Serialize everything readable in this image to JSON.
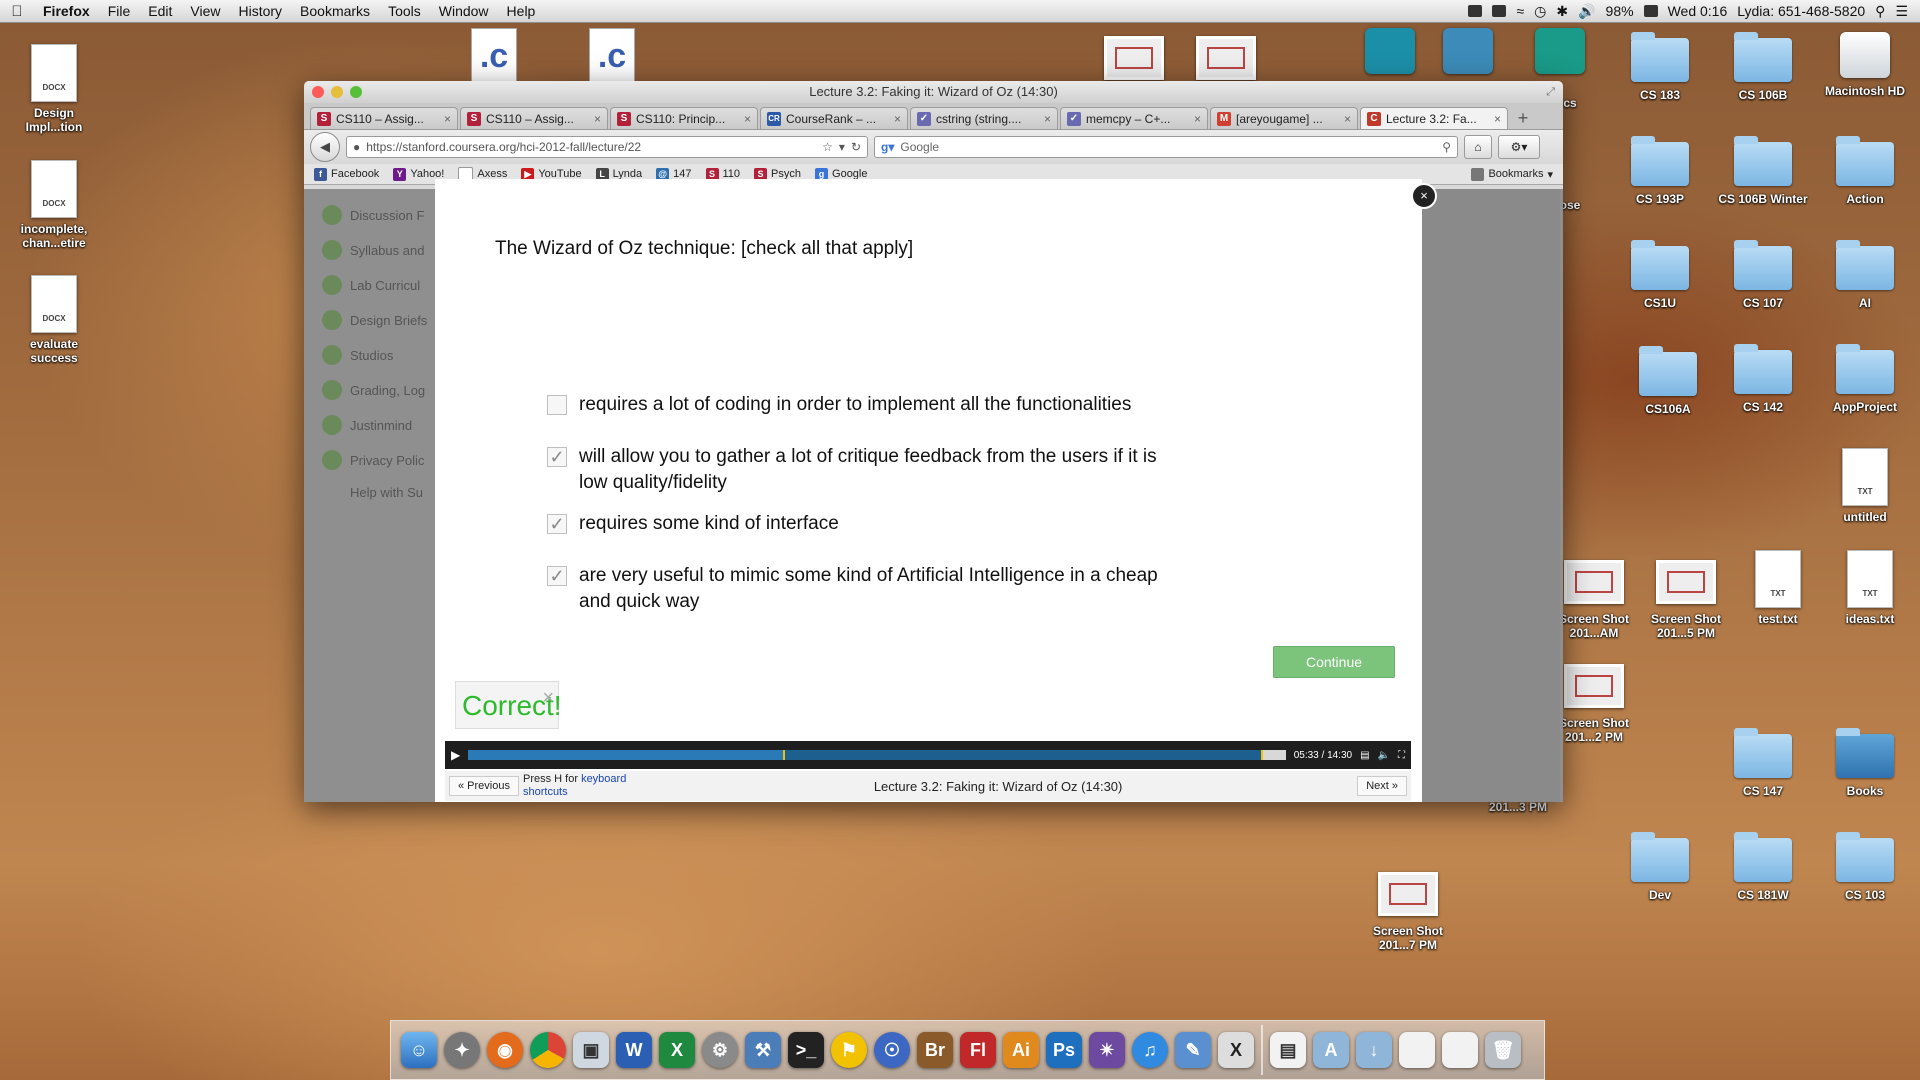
{
  "menubar": {
    "apple": "",
    "items": [
      "Firefox",
      "File",
      "Edit",
      "View",
      "History",
      "Bookmarks",
      "Tools",
      "Window",
      "Help"
    ],
    "battery": "98%",
    "clock": "Wed 0:16",
    "user": "Lydia: 651-468-5820"
  },
  "desktop_left": [
    {
      "label": "Design\nImpl...tion",
      "type": "DOCX"
    },
    {
      "label": "incomplete,\nchan...etire",
      "type": "DOCX"
    },
    {
      "label": "evaluate\nsuccess",
      "type": "DOCX"
    }
  ],
  "desktop_right": {
    "row1": [
      "CS 183",
      "CS 106B",
      "Macintosh HD"
    ],
    "row2": [
      "CS 193P",
      "CS 106B Winter",
      "Action"
    ],
    "row3": [
      "CS1U",
      "CS 107",
      "AI"
    ],
    "row4": [
      "CS106A",
      "CS 142",
      "AppProject"
    ],
    "untitled": "untitled",
    "txt_type": "TXT",
    "shot_row": [
      "Screen Shot 201...AM",
      "Screen Shot 201...5 PM",
      "test.txt",
      "ideas.txt"
    ],
    "shot2": "Screen Shot 201...2 PM",
    "bottom1": [
      "CS 147",
      "Books"
    ],
    "bottom2": [
      "Dev",
      "CS 181W",
      "CS 103"
    ],
    "shot3": "Screen Shot 201...3 PM",
    "shot4": "Screen Shot 201...7 PM",
    "partial": [
      "cs",
      "ose"
    ]
  },
  "window": {
    "title": "Lecture 3.2: Faking it: Wizard of Oz (14:30)",
    "tabs": [
      {
        "label": "CS110 – Assig...",
        "fav": "S",
        "color": "#b3203a"
      },
      {
        "label": "CS110 – Assig...",
        "fav": "S",
        "color": "#b3203a"
      },
      {
        "label": "CS110: Princip...",
        "fav": "S",
        "color": "#b3203a"
      },
      {
        "label": "CourseRank – ...",
        "fav": "CR",
        "color": "#2c5aa8"
      },
      {
        "label": "cstring (string....",
        "fav": "✓",
        "color": "#6a6ab0"
      },
      {
        "label": "memcpy – C+...",
        "fav": "✓",
        "color": "#6a6ab0"
      },
      {
        "label": "[areyougame] ...",
        "fav": "M",
        "color": "#d04030"
      },
      {
        "label": "Lecture 3.2: Fa...",
        "fav": "C",
        "color": "#c0392b"
      }
    ],
    "url": "https://stanford.coursera.org/hci-2012-fall/lecture/22",
    "search_placeholder": "Google",
    "bookmarks": [
      {
        "label": "Facebook",
        "fav": "f",
        "color": "#3b5998"
      },
      {
        "label": "Yahoo!",
        "fav": "Y",
        "color": "#6d1b8a"
      },
      {
        "label": "Axess",
        "fav": "",
        "color": "#999"
      },
      {
        "label": "YouTube",
        "fav": "▶",
        "color": "#cc1a1a"
      },
      {
        "label": "Lynda",
        "fav": "L",
        "color": "#444"
      },
      {
        "label": "147",
        "fav": "@",
        "color": "#2f6fb0"
      },
      {
        "label": "110",
        "fav": "S",
        "color": "#b3203a"
      },
      {
        "label": "Psych",
        "fav": "S",
        "color": "#b3203a"
      },
      {
        "label": "Google",
        "fav": "g",
        "color": "#3a74d8"
      }
    ],
    "bookmarks_menu": "Bookmarks"
  },
  "page": {
    "leftnav": [
      "Discussion F",
      "Syllabus and",
      "Lab Curricul",
      "Design Briefs",
      "Studios",
      "Grading, Log",
      "Justinmind",
      "Privacy Polic",
      "Help with Su"
    ],
    "question": "The Wizard of Oz technique: [check all that apply]",
    "options": [
      {
        "text": "requires a lot of coding in order to implement all the functionalities",
        "checked": false
      },
      {
        "text": "will allow you to gather a lot of critique feedback from the users if it is low quality/fidelity",
        "checked": true
      },
      {
        "text": "requires some kind of interface",
        "checked": true
      },
      {
        "text": "are very useful to mimic some kind of Artificial Intelligence in a cheap and quick way",
        "checked": true
      }
    ],
    "continue_label": "Continue",
    "result": "Correct!",
    "player": {
      "time": "05:33 / 14:30",
      "progress": 0.385
    },
    "lecture_bar": {
      "prev": "« Previous",
      "hint_prefix": "Press H for",
      "hint_link": "keyboard shortcuts",
      "title": "Lecture 3.2: Faking it: Wizard of Oz (14:30)",
      "next": "Next »"
    }
  },
  "dock": [
    "Finder",
    "Launchpad",
    "Firefox",
    "Chrome",
    "Preview",
    "Word",
    "Excel",
    "System Preferences",
    "Xcode",
    "Terminal",
    "Cyberduck",
    "Safari",
    "Bridge",
    "Flash",
    "Illustrator",
    "Photoshop",
    "Aperture",
    "iTunes",
    "Xcode2",
    "X11",
    "Documents",
    "Applications",
    "Downloads",
    "Screen Shot",
    "Screen Shot 2",
    "Trash"
  ]
}
